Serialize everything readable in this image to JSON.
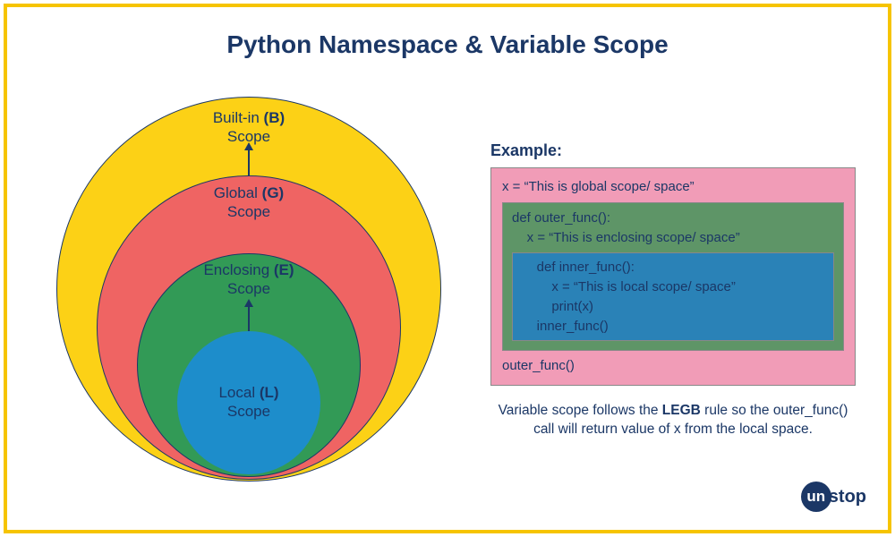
{
  "title": "Python Namespace & Variable Scope",
  "circles": {
    "builtin": {
      "name": "Built-in",
      "letter": "(B)",
      "sub": "Scope"
    },
    "global": {
      "name": "Global",
      "letter": "(G)",
      "sub": "Scope"
    },
    "enclose": {
      "name": "Enclosing",
      "letter": "(E)",
      "sub": "Scope"
    },
    "local": {
      "name": "Local",
      "letter": "(L)",
      "sub": "Scope"
    }
  },
  "example": {
    "heading": "Example:",
    "line_global": "x = “This is global scope/ space”",
    "line_outer_def": "def outer_func():",
    "line_outer_x": "    x = “This is enclosing scope/ space”",
    "line_inner_def": "    def inner_func():",
    "line_inner_x": "        x = “This is local scope/ space”",
    "line_inner_print": "        print(x)",
    "line_inner_call": "    inner_func()",
    "line_outer_call": "outer_func()"
  },
  "caption_pre": "Variable scope follows the ",
  "caption_bold": "LEGB",
  "caption_post": " rule so the outer_func() call will return value of x from the local space.",
  "logo": {
    "bubble": "un",
    "rest": "stop"
  },
  "colors": {
    "builtin": "#fcd116",
    "global": "#ef6463",
    "enclose": "#329a56",
    "local": "#1d8dcb",
    "pink": "#f19cb7",
    "green": "#5e9567",
    "blue": "#2a82b7",
    "navy": "#1b3766",
    "border": "#f6c400"
  }
}
